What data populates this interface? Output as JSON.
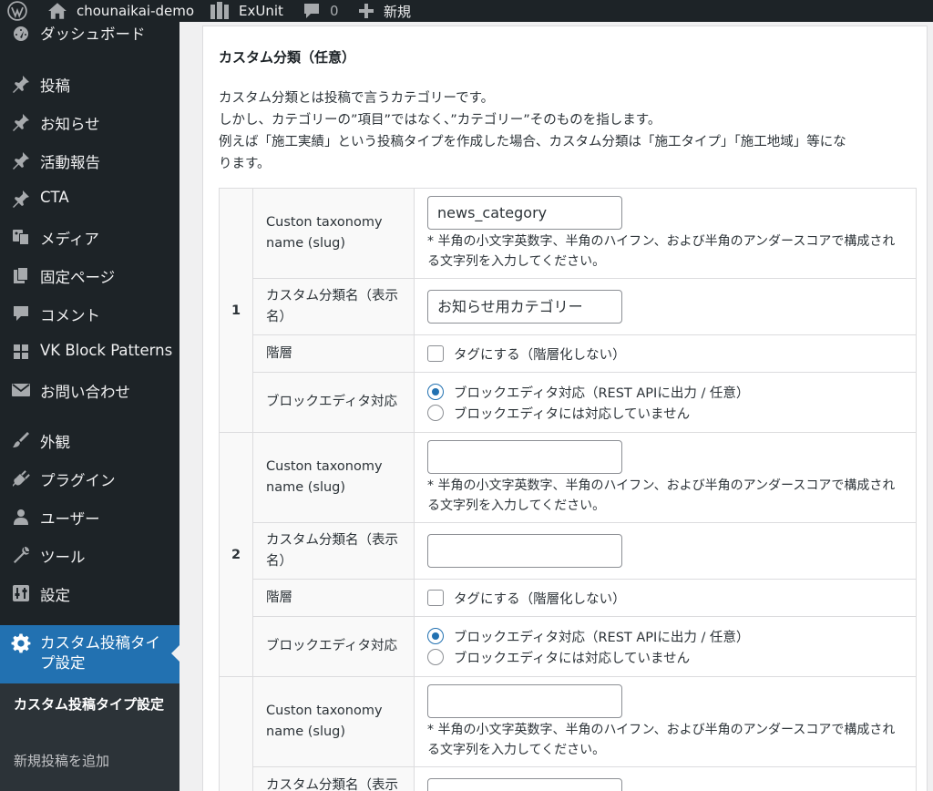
{
  "adminbar": {
    "site_name": "chounaikai-demo",
    "exunit_label": "ExUnit",
    "comments_count": "0",
    "new_label": "新規"
  },
  "menu": {
    "items": [
      {
        "label": "ダッシュボード",
        "icon": "dashboard-icon"
      },
      {
        "label": "投稿",
        "icon": "pin-icon"
      },
      {
        "label": "お知らせ",
        "icon": "pin-icon"
      },
      {
        "label": "活動報告",
        "icon": "pin-icon"
      },
      {
        "label": "CTA",
        "icon": "pin-icon"
      },
      {
        "label": "メディア",
        "icon": "media-icon"
      },
      {
        "label": "固定ページ",
        "icon": "page-icon"
      },
      {
        "label": "コメント",
        "icon": "comment-icon"
      },
      {
        "label": "VK Block Patterns",
        "icon": "grid-icon"
      },
      {
        "label": "お問い合わせ",
        "icon": "mail-icon"
      },
      {
        "label": "外観",
        "icon": "brush-icon"
      },
      {
        "label": "プラグイン",
        "icon": "plug-icon"
      },
      {
        "label": "ユーザー",
        "icon": "user-icon"
      },
      {
        "label": "ツール",
        "icon": "wrench-icon"
      },
      {
        "label": "設定",
        "icon": "settings-icon"
      }
    ],
    "current": {
      "label": "カスタム投稿タイプ設定",
      "icon": "gear-icon"
    },
    "submenu": {
      "title": "カスタム投稿タイプ設定",
      "add_new": "新規投稿を追加"
    }
  },
  "section": {
    "title": "カスタム分類（任意）",
    "description": [
      "カスタム分類とは投稿で言うカテゴリーです。",
      "しかし、カテゴリーの”項目”ではなく、”カテゴリー”そのものを指します。",
      "例えば「施工実績」という投稿タイプを作成した場合、カスタム分類は「施工タイプ」「施工地域」等にな",
      "ります。"
    ]
  },
  "labels": {
    "slug": "Custon taxonomy name (slug)",
    "slug_note": "* 半角の小文字英数字、半角のハイフン、および半角のアンダースコアで構成される文字列を入力してください。",
    "display_name": "カスタム分類名（表示名）",
    "hierarchy": "階層",
    "hierarchy_option": "タグにする（階層化しない）",
    "block_editor": "ブロックエディタ対応",
    "block_editor_on": "ブロックエディタ対応（REST APIに出力 / 任意）",
    "block_editor_off": "ブロックエディタには対応していません"
  },
  "rows": [
    {
      "num": "1",
      "slug": "news_category",
      "name": "お知らせ用カテゴリー",
      "tag": false,
      "rest": true
    },
    {
      "num": "2",
      "slug": "",
      "name": "",
      "tag": false,
      "rest": true
    },
    {
      "num": "",
      "slug": "",
      "name": "",
      "tag": false,
      "rest": true
    }
  ]
}
